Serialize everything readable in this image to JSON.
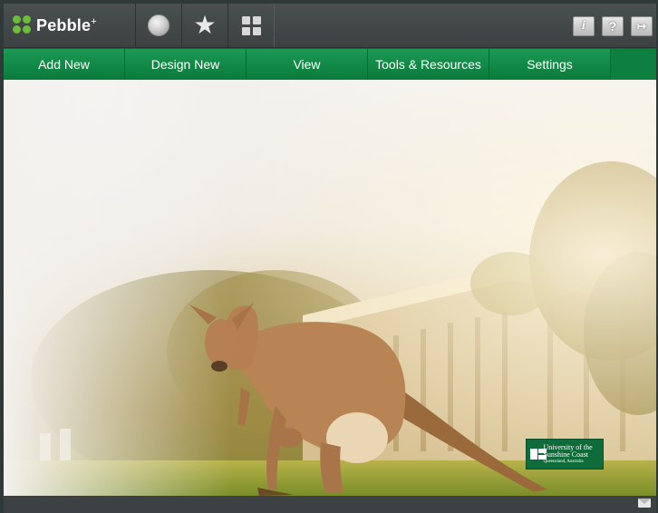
{
  "app": {
    "brand": "Pebble",
    "brand_sup": "+"
  },
  "toolbar": {
    "icons": [
      "globe-icon",
      "star-icon",
      "dashboard-icon"
    ],
    "right_buttons": [
      {
        "name": "info-icon",
        "glyph": "i"
      },
      {
        "name": "help-icon",
        "glyph": "?"
      },
      {
        "name": "logout-icon",
        "glyph": "↦"
      }
    ]
  },
  "nav": {
    "items": [
      {
        "label": "Add New"
      },
      {
        "label": "Design New"
      },
      {
        "label": "View"
      },
      {
        "label": "Tools & Resources"
      },
      {
        "label": "Settings"
      }
    ]
  },
  "hero": {
    "badge_line1": "University of the Sunshine Coast",
    "badge_line2": "Queensland, Australia"
  },
  "footer": {
    "mail_icon": "mail-icon"
  },
  "colors": {
    "nav_green": "#0d7f3f",
    "brand_green": "#6cbb3c",
    "topbar": "#3c4142"
  }
}
